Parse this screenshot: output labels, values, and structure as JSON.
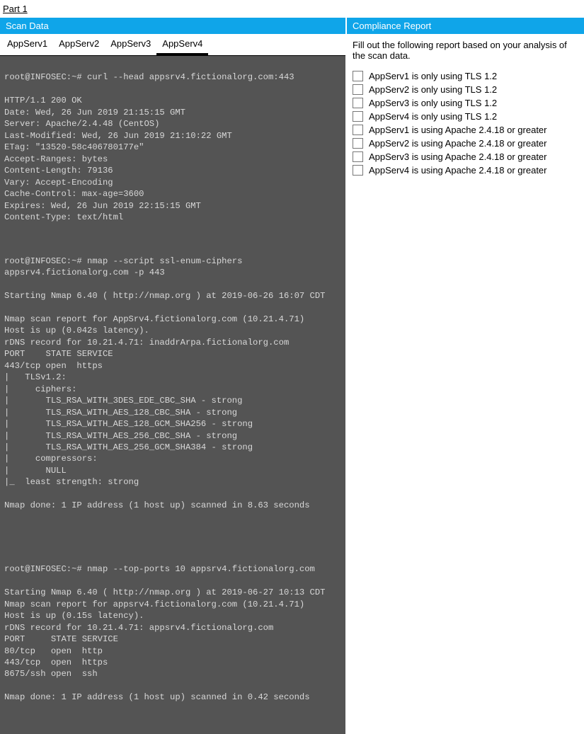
{
  "partLabel": "Part 1",
  "leftHeader": "Scan Data",
  "rightHeader": "Compliance Report",
  "tabs": [
    {
      "label": "AppServ1",
      "active": false
    },
    {
      "label": "AppServ2",
      "active": false
    },
    {
      "label": "AppServ3",
      "active": false
    },
    {
      "label": "AppServ4",
      "active": true
    }
  ],
  "rightInstruction": "Fill out the following report based on your analysis of the scan data.",
  "checks": [
    {
      "label": "AppServ1 is only using TLS 1.2"
    },
    {
      "label": "AppServ2 is only using TLS 1.2"
    },
    {
      "label": "AppServ3 is only using TLS 1.2"
    },
    {
      "label": "AppServ4 is only using TLS 1.2"
    },
    {
      "label": "AppServ1 is using Apache 2.4.18 or greater"
    },
    {
      "label": "AppServ2 is using Apache 2.4.18 or greater"
    },
    {
      "label": "AppServ3 is using Apache 2.4.18 or greater"
    },
    {
      "label": "AppServ4 is using Apache 2.4.18 or greater"
    }
  ],
  "terminal": {
    "block1": "root@INFOSEC:~# curl --head appsrv4.fictionalorg.com:443\n\nHTTP/1.1 200 OK\nDate: Wed, 26 Jun 2019 21:15:15 GMT\nServer: Apache/2.4.48 (CentOS)\nLast-Modified: Wed, 26 Jun 2019 21:10:22 GMT\nETag: \"13520-58c406780177e\"\nAccept-Ranges: bytes\nContent-Length: 79136\nVary: Accept-Encoding\nCache-Control: max-age=3600\nExpires: Wed, 26 Jun 2019 22:15:15 GMT\nContent-Type: text/html",
    "block2": "root@INFOSEC:~# nmap --script ssl-enum-ciphers appsrv4.fictionalorg.com -p 443\n\nStarting Nmap 6.40 ( http://nmap.org ) at 2019-06-26 16:07 CDT\n\nNmap scan report for AppSrv4.fictionalorg.com (10.21.4.71)\nHost is up (0.042s latency).\nrDNS record for 10.21.4.71: inaddrArpa.fictionalorg.com\nPORT    STATE SERVICE\n443/tcp open  https\n|   TLSv1.2:\n|     ciphers:\n|       TLS_RSA_WITH_3DES_EDE_CBC_SHA - strong\n|       TLS_RSA_WITH_AES_128_CBC_SHA - strong\n|       TLS_RSA_WITH_AES_128_GCM_SHA256 - strong\n|       TLS_RSA_WITH_AES_256_CBC_SHA - strong\n|       TLS_RSA_WITH_AES_256_GCM_SHA384 - strong\n|     compressors:\n|       NULL\n|_  least strength: strong\n\nNmap done: 1 IP address (1 host up) scanned in 8.63 seconds",
    "block3": "root@INFOSEC:~# nmap --top-ports 10 appsrv4.fictionalorg.com\n\nStarting Nmap 6.40 ( http://nmap.org ) at 2019-06-27 10:13 CDT\nNmap scan report for appsrv4.fictionalorg.com (10.21.4.71)\nHost is up (0.15s latency).\nrDNS record for 10.21.4.71: appsrv4.fictionalorg.com\nPORT     STATE SERVICE\n80/tcp   open  http\n443/tcp  open  https\n8675/ssh open  ssh\n\nNmap done: 1 IP address (1 host up) scanned in 0.42 seconds"
  }
}
